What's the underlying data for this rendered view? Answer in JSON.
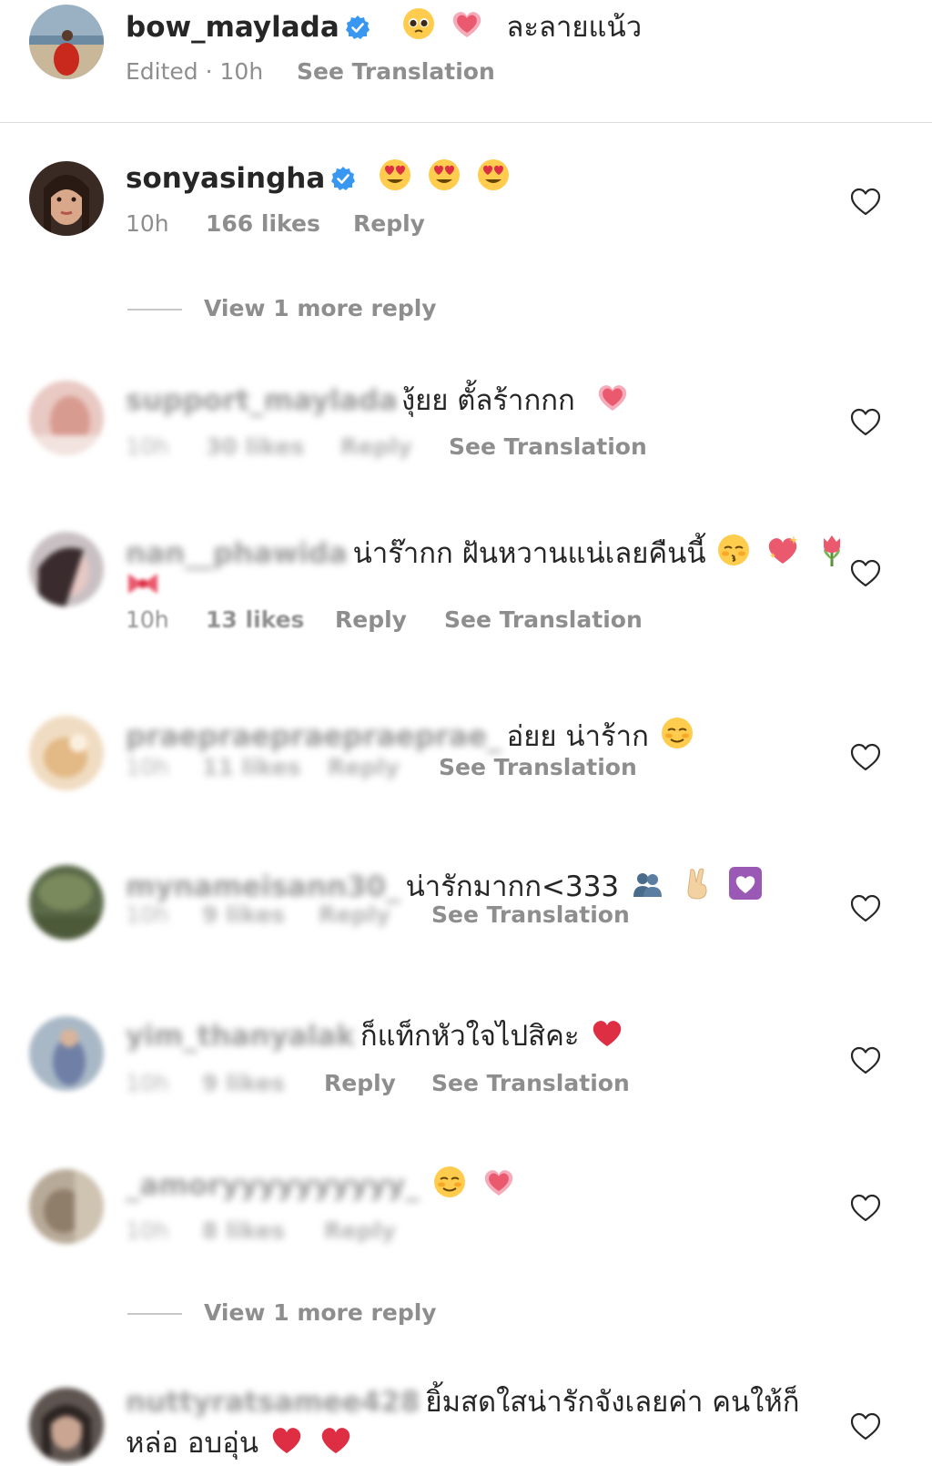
{
  "caption": {
    "username": "bow_maylada",
    "text": "ละลายแน้ว",
    "emojis": [
      "pleading-face-emoji",
      "growing-heart-emoji"
    ],
    "edited": "Edited · 10h",
    "see_translation": "See Translation"
  },
  "comments": [
    {
      "username": "sonyasingha",
      "verified": true,
      "text": "",
      "emojis": [
        "heart-eyes-emoji",
        "heart-eyes-emoji",
        "heart-eyes-emoji"
      ],
      "time": "10h",
      "likes": "166 likes",
      "reply": "Reply",
      "view_more": "View 1 more reply"
    },
    {
      "username": "support_maylada",
      "text": "งุ้ยย ตั้ลร้ากกก",
      "emojis": [
        "growing-heart-emoji"
      ],
      "time": "10h",
      "likes": "30 likes",
      "reply": "Reply",
      "see_translation": "See Translation"
    },
    {
      "username": "nan__phawida",
      "text": "น่าร๊ากก ฝันหวานแน่เลยคืนนี้",
      "emojis": [
        "kissing-closed-eyes-emoji",
        "sparkling-heart-emoji",
        "tulip-emoji",
        "ribbon-emoji"
      ],
      "time": "10h",
      "likes": "13 likes",
      "reply": "Reply",
      "see_translation": "See Translation"
    },
    {
      "username": "praepraepraepraeprae_",
      "text": "อ่ยย น่าร้าก",
      "emojis": [
        "smiling-face-emoji"
      ],
      "time": "10h",
      "likes": "11 likes",
      "reply": "Reply",
      "see_translation": "See Translation"
    },
    {
      "username": "mynameisann30_",
      "text": "น่ารักมากก<333",
      "emojis": [
        "busts-emoji",
        "victory-hand-emoji",
        "purple-heart-emoji"
      ],
      "time": "10h",
      "likes": "9 likes",
      "reply": "Reply",
      "see_translation": "See Translation"
    },
    {
      "username": "yim_thanyalak",
      "text": "ก็แท็กหัวใจไปสิคะ",
      "emojis": [
        "red-heart-emoji"
      ],
      "time": "10h",
      "likes": "9 likes",
      "reply": "Reply",
      "see_translation": "See Translation"
    },
    {
      "username": "_amoryyyyyyyyyy_",
      "text": "",
      "emojis": [
        "smiling-face-emoji",
        "growing-heart-emoji"
      ],
      "time": "10h",
      "likes": "8 likes",
      "reply": "Reply",
      "view_more": "View 1 more reply"
    },
    {
      "username": "nuttyratsamee428",
      "text": "ยิ้มสดใสน่ารักจังเลยค่า คนให้ก็",
      "text_line2": "หล่อ อบอุ่น",
      "emojis": [
        "red-heart-emoji",
        "red-heart-emoji"
      ]
    }
  ],
  "colors": {
    "text": "#262626",
    "secondary": "#8e8e8e",
    "verified": "#3897f0",
    "divider": "#dbdbdb"
  }
}
